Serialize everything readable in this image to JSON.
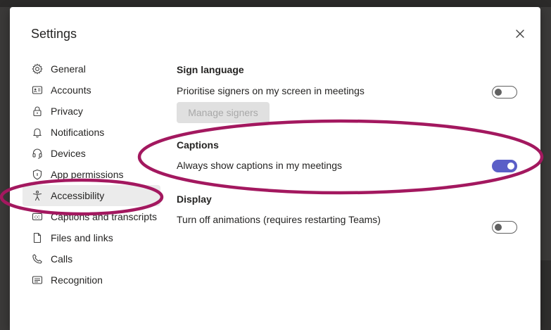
{
  "dialog": {
    "title": "Settings",
    "close_icon": "close-icon"
  },
  "nav": {
    "items": [
      {
        "label": "General",
        "icon": "gear-icon"
      },
      {
        "label": "Accounts",
        "icon": "id-card-icon"
      },
      {
        "label": "Privacy",
        "icon": "lock-icon"
      },
      {
        "label": "Notifications",
        "icon": "bell-icon"
      },
      {
        "label": "Devices",
        "icon": "headset-icon"
      },
      {
        "label": "App permissions",
        "icon": "shield-icon"
      },
      {
        "label": "Accessibility",
        "icon": "accessibility-icon",
        "active": true
      },
      {
        "label": "Captions and transcripts",
        "icon": "closed-captions-icon"
      },
      {
        "label": "Files and links",
        "icon": "document-icon"
      },
      {
        "label": "Calls",
        "icon": "phone-icon"
      },
      {
        "label": "Recognition",
        "icon": "recognition-icon"
      }
    ]
  },
  "sign_language": {
    "title": "Sign language",
    "prioritise_label": "Prioritise signers on my screen in meetings",
    "prioritise_on": false,
    "manage_button": "Manage signers"
  },
  "captions": {
    "title": "Captions",
    "always_show_label": "Always show captions in my meetings",
    "always_show_on": true
  },
  "display": {
    "title": "Display",
    "animations_label": "Turn off animations (requires restarting Teams)",
    "animations_on": false
  },
  "colors": {
    "accent": "#5b5fc7",
    "highlight_ellipse": "#a3185f"
  }
}
